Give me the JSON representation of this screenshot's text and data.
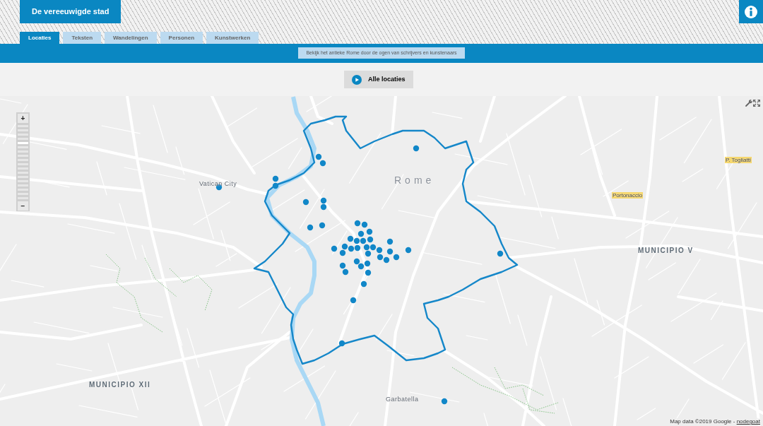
{
  "header": {
    "title": "De vereeuwigde stad"
  },
  "tabs": [
    {
      "label": "Locaties",
      "selected": true
    },
    {
      "label": "Teksten",
      "selected": false
    },
    {
      "label": "Wandelingen",
      "selected": false
    },
    {
      "label": "Personen",
      "selected": false
    },
    {
      "label": "Kunstwerken",
      "selected": false
    }
  ],
  "tagline": "Bekijk het antieke Rome door de ogen van schrijvers en kunstenaars",
  "toolbar": {
    "button": "Alle locaties"
  },
  "map": {
    "zoom": {
      "in": "+",
      "out": "−",
      "level": 0.76
    },
    "labels": [
      {
        "text": "P. Togliatti",
        "kind": "station"
      },
      {
        "text": "Vatican City",
        "kind": "place"
      },
      {
        "text": "Rome",
        "kind": "city"
      },
      {
        "text": "Portonaccio",
        "kind": "station"
      },
      {
        "text": "MUNICIPIO V",
        "kind": "district"
      },
      {
        "text": "MUNICIPIO XII",
        "kind": "district"
      },
      {
        "text": "Garbatella",
        "kind": "place"
      }
    ],
    "attribution": {
      "text": "Map data ©2019 Google - ",
      "link": "nodegoat"
    }
  }
}
